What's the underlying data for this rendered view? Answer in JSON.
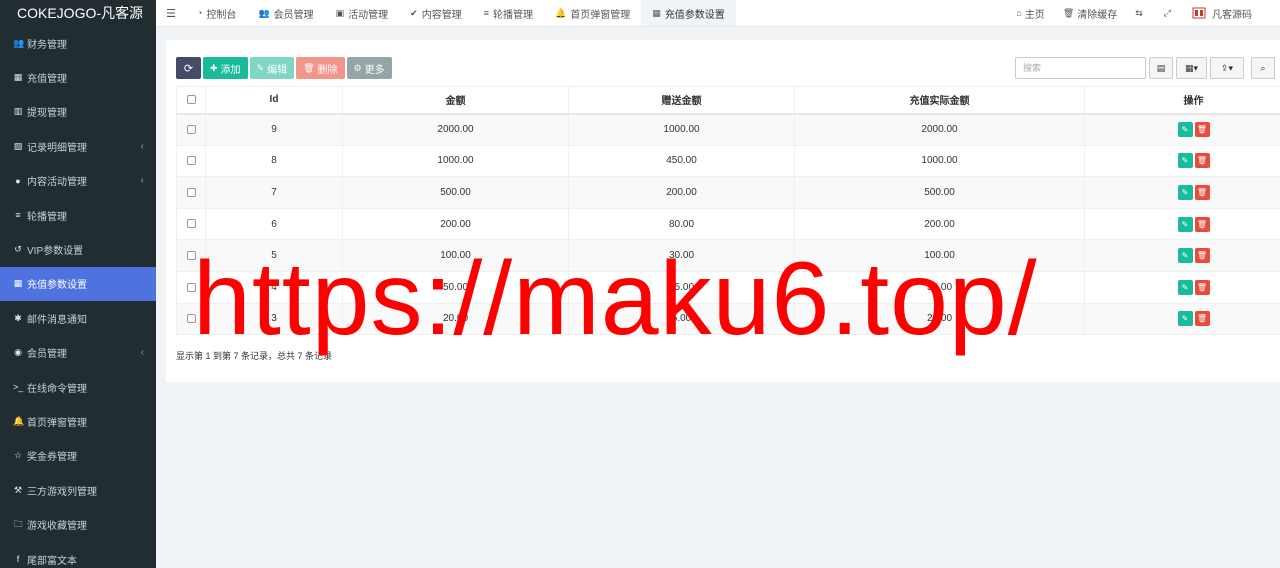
{
  "brand": "COKEJOGO-凡客源",
  "sidebar": {
    "items": [
      {
        "label": "财务管理",
        "icon": "users-icon",
        "glyph": "👥",
        "caret": false,
        "active": false
      },
      {
        "label": "充值管理",
        "icon": "grid-icon",
        "glyph": "▦",
        "caret": false,
        "active": false
      },
      {
        "label": "提现管理",
        "icon": "bank-icon",
        "glyph": "▥",
        "caret": false,
        "active": false
      },
      {
        "label": "记录明细管理",
        "icon": "bar-chart-icon",
        "glyph": "▨",
        "caret": true,
        "active": false
      },
      {
        "label": "内容活动管理",
        "icon": "circle-icon",
        "glyph": "●",
        "caret": true,
        "active": false
      },
      {
        "label": "轮播管理",
        "icon": "bars-icon",
        "glyph": "≡",
        "caret": false,
        "active": false
      },
      {
        "label": "VIP参数设置",
        "icon": "history-icon",
        "glyph": "↺",
        "caret": false,
        "active": false
      },
      {
        "label": "充值参数设置",
        "icon": "grid-icon",
        "glyph": "▦",
        "caret": false,
        "active": true
      },
      {
        "label": "邮件消息通知",
        "icon": "asterisk-icon",
        "glyph": "✱",
        "caret": false,
        "active": false
      },
      {
        "label": "会员管理",
        "icon": "user-circle-icon",
        "glyph": "◉",
        "caret": true,
        "active": false
      },
      {
        "label": "在线命令管理",
        "icon": "terminal-icon",
        "glyph": ">_",
        "caret": false,
        "active": false
      },
      {
        "label": "首页弹窗管理",
        "icon": "bell-icon",
        "glyph": "🔔",
        "caret": false,
        "active": false
      },
      {
        "label": "奖金券管理",
        "icon": "star-icon",
        "glyph": "☆",
        "caret": false,
        "active": false
      },
      {
        "label": "三方游戏列管理",
        "icon": "gavel-icon",
        "glyph": "⚒",
        "caret": false,
        "active": false
      },
      {
        "label": "游戏收藏管理",
        "icon": "folder-icon",
        "glyph": "🗀",
        "caret": false,
        "active": false
      },
      {
        "label": "尾部富文本",
        "icon": "facebook-icon",
        "glyph": "f",
        "caret": false,
        "active": false
      }
    ]
  },
  "topnav": {
    "tabs": [
      {
        "label": "控制台",
        "icon": "dashboard-icon",
        "glyph": "◔",
        "active": false
      },
      {
        "label": "会员管理",
        "icon": "users-icon",
        "glyph": "👥",
        "active": false
      },
      {
        "label": "活动管理",
        "icon": "calendar-icon",
        "glyph": "▣",
        "active": false
      },
      {
        "label": "内容管理",
        "icon": "check-circle-icon",
        "glyph": "✔",
        "active": false
      },
      {
        "label": "轮播管理",
        "icon": "bars-icon",
        "glyph": "≡",
        "active": false
      },
      {
        "label": "首页弹窗管理",
        "icon": "bell-icon",
        "glyph": "🔔",
        "active": false
      },
      {
        "label": "充值参数设置",
        "icon": "grid-icon",
        "glyph": "▦",
        "active": true
      }
    ],
    "right": {
      "home": "主页",
      "clear_cache": "清除缓存",
      "username": "凡客源码"
    }
  },
  "toolbar": {
    "add": "添加",
    "edit": "编辑",
    "delete": "删除",
    "more": "更多"
  },
  "search": {
    "placeholder": "搜索"
  },
  "table": {
    "headers": [
      "Id",
      "金额",
      "赠送金额",
      "充值实际金额",
      "操作"
    ],
    "rows": [
      {
        "id": "9",
        "amount": "2000.00",
        "bonus": "1000.00",
        "actual": "2000.00"
      },
      {
        "id": "8",
        "amount": "1000.00",
        "bonus": "450.00",
        "actual": "1000.00"
      },
      {
        "id": "7",
        "amount": "500.00",
        "bonus": "200.00",
        "actual": "500.00"
      },
      {
        "id": "6",
        "amount": "200.00",
        "bonus": "80.00",
        "actual": "200.00"
      },
      {
        "id": "5",
        "amount": "100.00",
        "bonus": "30.00",
        "actual": "100.00"
      },
      {
        "id": "4",
        "amount": "50.00",
        "bonus": "15.00",
        "actual": "50.00"
      },
      {
        "id": "3",
        "amount": "20.00",
        "bonus": "5.00",
        "actual": "20.00"
      }
    ]
  },
  "pagination_text": "显示第 1 到第 7 条记录，总共 7 条记录",
  "watermark": "https://maku6.top/",
  "colors": {
    "sidebar_bg": "#222d32",
    "active_blue": "#4e73df",
    "success": "#18bc9c",
    "danger": "#e74c3c",
    "watermark": "#ff0000"
  }
}
